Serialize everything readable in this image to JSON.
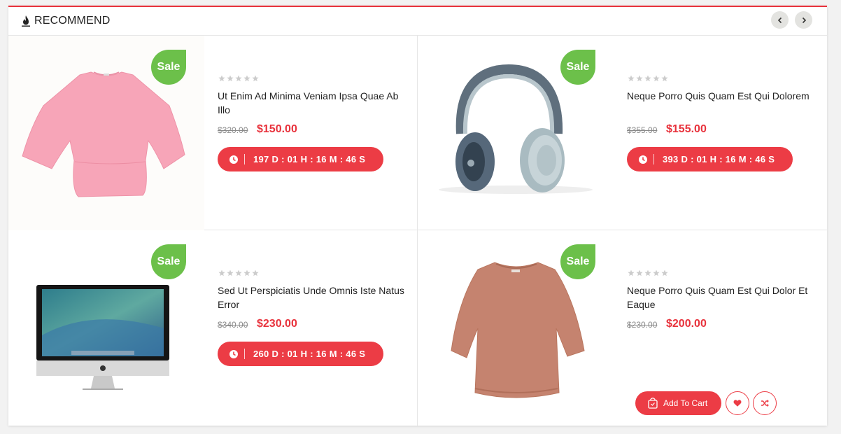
{
  "header": {
    "title": "RECOMMEND",
    "icon": "fire-icon"
  },
  "colors": {
    "accent": "#e8323c",
    "sale": "#6cc04a"
  },
  "products": [
    {
      "name": "Ut Enim Ad Minima Veniam Ipsa Quae Ab Illo",
      "old_price": "$320.00",
      "price": "$150.00",
      "sale": "Sale",
      "countdown": "197 D : 01 H : 16 M : 46 S",
      "rating": 0
    },
    {
      "name": "Neque Porro Quis Quam Est Qui Dolorem",
      "old_price": "$355.00",
      "price": "$155.00",
      "sale": "Sale",
      "countdown": "393 D : 01 H : 16 M : 46 S",
      "rating": 0
    },
    {
      "name": "Sed Ut Perspiciatis Unde Omnis Iste Natus Error",
      "old_price": "$340.00",
      "price": "$230.00",
      "sale": "Sale",
      "countdown": "260 D : 01 H : 16 M : 46 S",
      "rating": 0
    },
    {
      "name": "Neque Porro Quis Quam Est Qui Dolor Et Eaque",
      "old_price": "$230.00",
      "price": "$200.00",
      "sale": "Sale",
      "add_to_cart": "Add To Cart",
      "rating": 0
    }
  ]
}
